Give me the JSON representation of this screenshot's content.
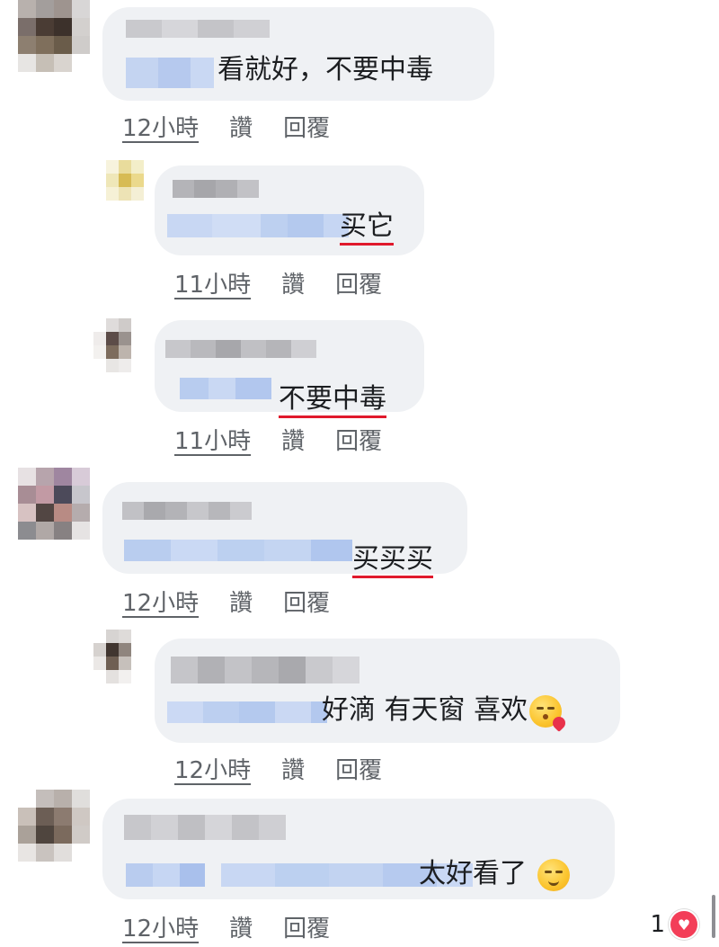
{
  "comments": [
    {
      "text_prefix": "看就好，不要中毒",
      "underlined": "",
      "meta": {
        "time": "12小時",
        "like": "讚",
        "reply": "回覆"
      }
    },
    {
      "text_prefix": "",
      "underlined": "买它",
      "meta": {
        "time": "11小時",
        "like": "讚",
        "reply": "回覆"
      }
    },
    {
      "text_prefix": "",
      "underlined": "不要中毒",
      "meta": {
        "time": "11小時",
        "like": "讚",
        "reply": "回覆"
      }
    },
    {
      "text_prefix": "",
      "underlined": "买买买",
      "meta": {
        "time": "12小時",
        "like": "讚",
        "reply": "回覆"
      }
    },
    {
      "text_prefix": "好滴 有天窗 喜欢",
      "underlined": "",
      "emoji": "kissing-face-with-heart",
      "meta": {
        "time": "12小時",
        "like": "讚",
        "reply": "回覆"
      }
    },
    {
      "text_prefix": "太好看了 ",
      "underlined": "",
      "emoji": "relieved-face",
      "meta": {
        "time": "12小時",
        "like": "讚",
        "reply": "回覆"
      },
      "reaction": {
        "count": "1",
        "icon": "heart-reaction"
      }
    }
  ],
  "colors": {
    "bubble": "#eff1f4",
    "underline": "#e0192c",
    "meta_text": "#5f6368",
    "mention_blur": "#b8cdf0"
  }
}
